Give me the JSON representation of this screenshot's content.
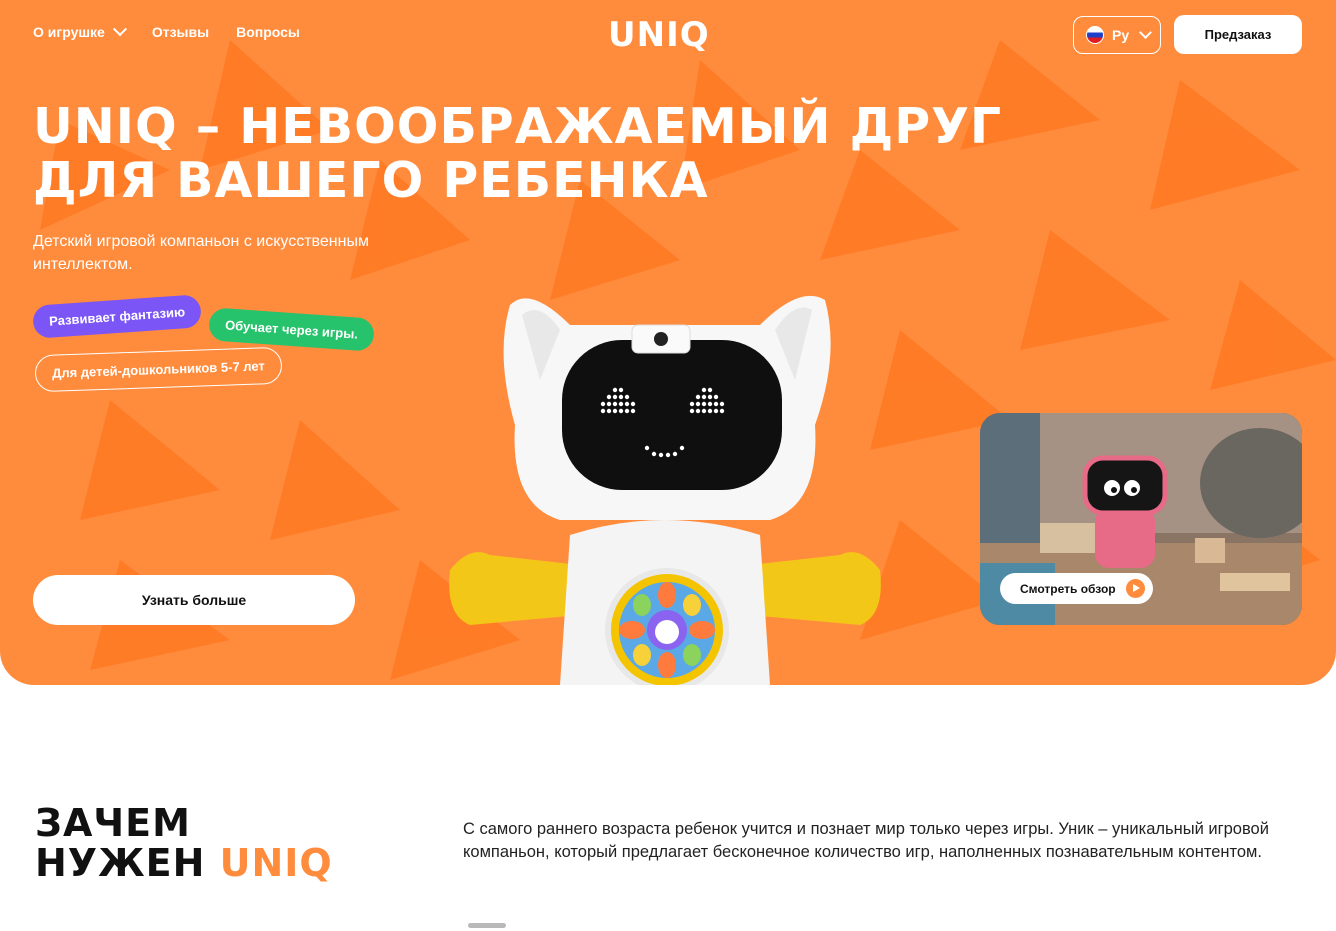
{
  "nav": {
    "about": "О игрушке",
    "reviews": "Отзывы",
    "faq": "Вопросы",
    "logo": "UNIQ",
    "language": "Ру",
    "preorder": "Предзаказ"
  },
  "hero": {
    "title_line1": "UNIQ – НЕВООБРАЖАЕМЫЙ ДРУГ",
    "title_line2": "ДЛЯ ВАШЕГО РЕБЕНКА",
    "subtitle": "Детский игровой компаньон с искусственным интеллектом.",
    "tags": [
      "Развивает фантазию",
      "Обучает через игры.",
      "Для детей-дошкольников 5-7 лет"
    ],
    "cta": "Узнать больше",
    "video_cta": "Смотреть обзор"
  },
  "why": {
    "title_line1": "ЗАЧЕМ",
    "title_line2_a": "НУЖЕН ",
    "title_line2_b": "UNIQ",
    "text": "С самого раннего возраста ребенок учится и познает мир только через игры. Уник – уникальный игровой компаньон, который предлагает бесконечное количество игр, наполненных познавательным контентом."
  },
  "colors": {
    "hero_bg": "#ff8c3d",
    "tag_purple": "#7b55f5",
    "tag_green": "#27c26c",
    "accent": "#ff8c3d"
  },
  "icons": [
    "chevron-down-icon",
    "russia-flag-icon",
    "play-icon"
  ]
}
